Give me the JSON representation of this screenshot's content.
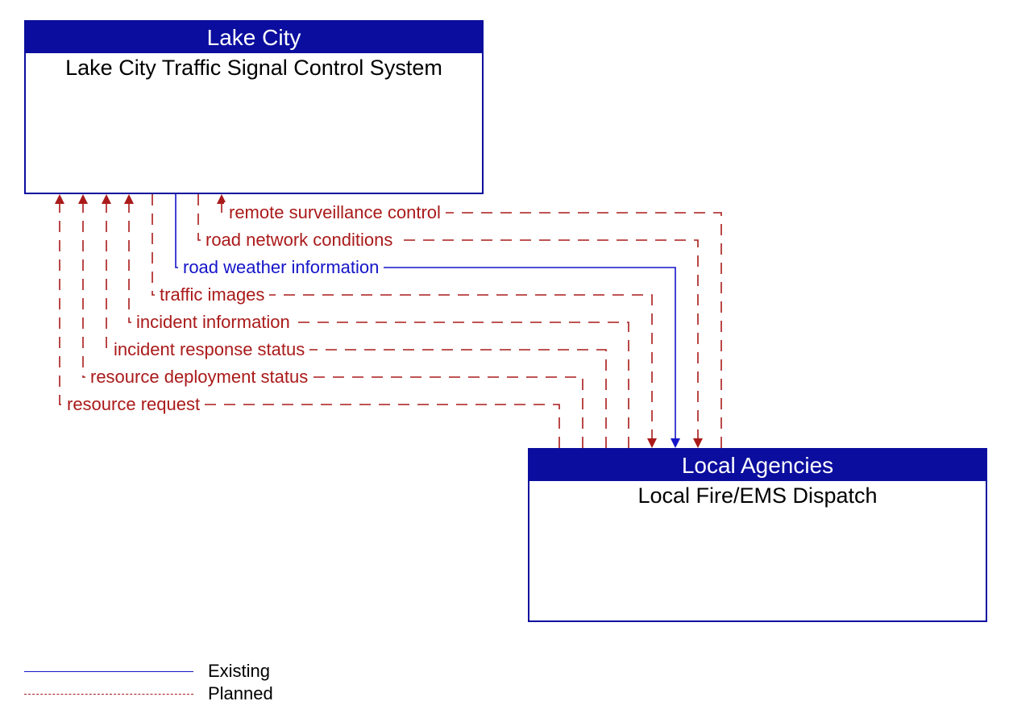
{
  "box_top": {
    "header": "Lake City",
    "title": "Lake City Traffic Signal Control System"
  },
  "box_bottom": {
    "header": "Local Agencies",
    "title": "Local Fire/EMS Dispatch"
  },
  "flows": {
    "f1": "remote surveillance control",
    "f2": "road network conditions",
    "f3": "road weather information",
    "f4": "traffic images",
    "f5": "incident information",
    "f6": "incident response status",
    "f7": "resource deployment status",
    "f8": "resource request"
  },
  "legend": {
    "existing": "Existing",
    "planned": "Planned"
  },
  "colors": {
    "blue": "#0b0d9e",
    "red": "#aa1a1a",
    "link_blue": "#1414c8"
  }
}
